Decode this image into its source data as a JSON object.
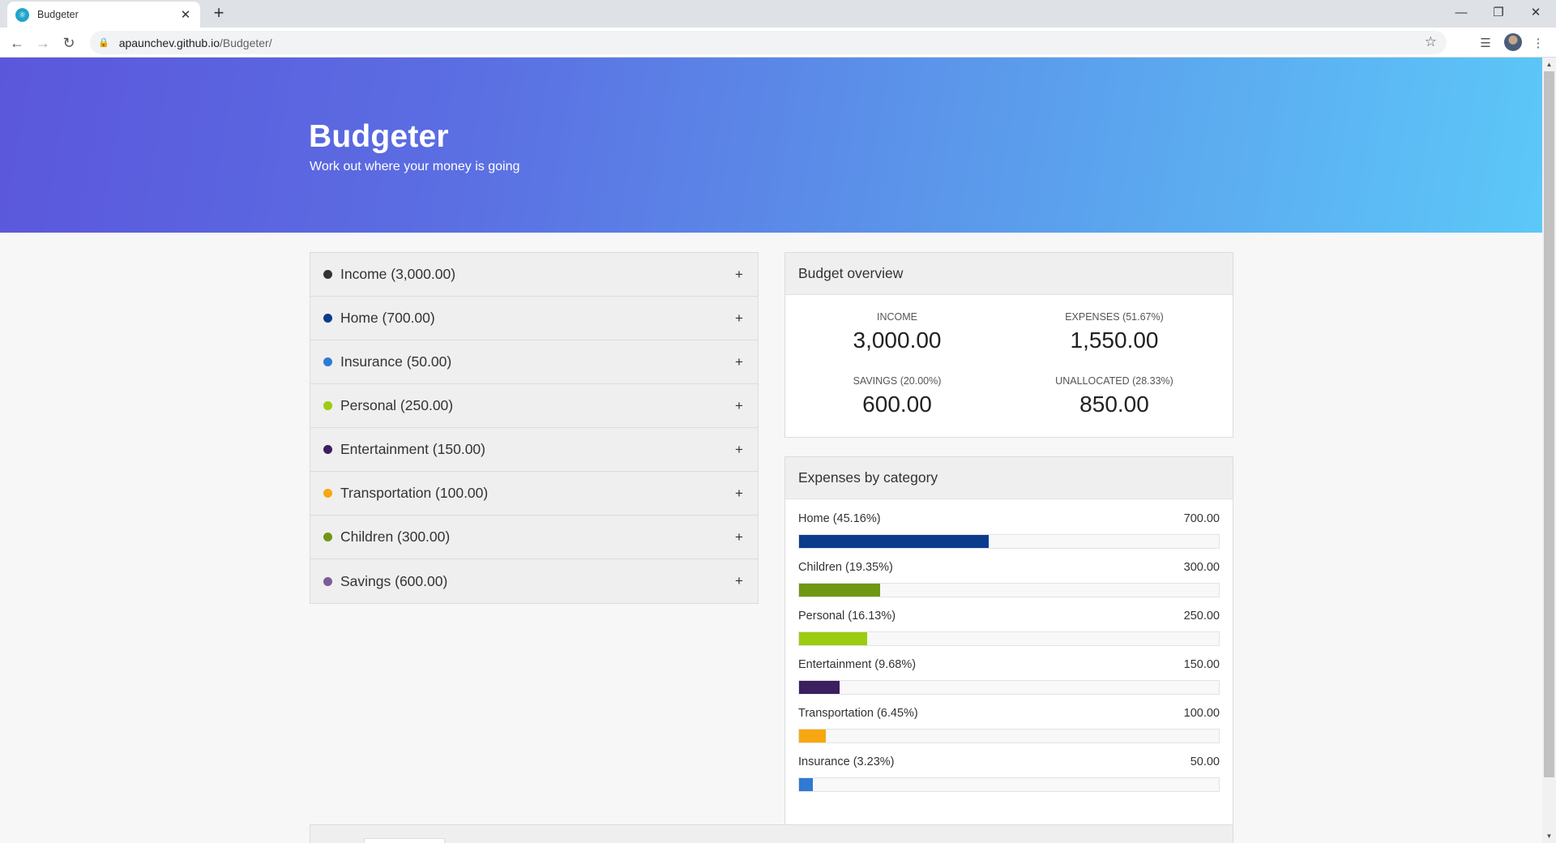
{
  "browser": {
    "tab_title": "Budgeter",
    "tab_close": "✕",
    "new_tab": "+",
    "url_host": "apaunchev.github.io",
    "url_path": "/Budgeter/"
  },
  "hero": {
    "title": "Budgeter",
    "subtitle": "Work out where your money is going"
  },
  "categories": [
    {
      "label": "Income (3,000.00)",
      "color": "#333333",
      "plus": "+"
    },
    {
      "label": "Home (700.00)",
      "color": "#0b3c8c",
      "plus": "+"
    },
    {
      "label": "Insurance (50.00)",
      "color": "#2f7ad4",
      "plus": "+"
    },
    {
      "label": "Personal (250.00)",
      "color": "#9ccc10",
      "plus": "+"
    },
    {
      "label": "Entertainment (150.00)",
      "color": "#3b1f5e",
      "plus": "+"
    },
    {
      "label": "Transportation (100.00)",
      "color": "#f7a712",
      "plus": "+"
    },
    {
      "label": "Children (300.00)",
      "color": "#6f9713",
      "plus": "+"
    },
    {
      "label": "Savings (600.00)",
      "color": "#7c5c96",
      "plus": "+"
    }
  ],
  "overview": {
    "title": "Budget overview",
    "income_label": "INCOME",
    "income_value": "3,000.00",
    "expenses_label": "EXPENSES (51.67%)",
    "expenses_value": "1,550.00",
    "savings_label": "SAVINGS (20.00%)",
    "savings_value": "600.00",
    "unallocated_label": "UNALLOCATED (28.33%)",
    "unallocated_value": "850.00"
  },
  "expenses": {
    "title": "Expenses by category",
    "items": [
      {
        "label": "Home (45.16%)",
        "value": "700.00",
        "fill_percent": 45.16,
        "color": "#0b3c8c"
      },
      {
        "label": "Children (19.35%)",
        "value": "300.00",
        "fill_percent": 19.35,
        "color": "#6f9713"
      },
      {
        "label": "Personal (16.13%)",
        "value": "250.00",
        "fill_percent": 16.13,
        "color": "#9ccc10"
      },
      {
        "label": "Entertainment (9.68%)",
        "value": "150.00",
        "fill_percent": 9.68,
        "color": "#3b1f5e"
      },
      {
        "label": "Transportation (6.45%)",
        "value": "100.00",
        "fill_percent": 6.45,
        "color": "#f7a712"
      },
      {
        "label": "Insurance (3.23%)",
        "value": "50.00",
        "fill_percent": 3.23,
        "color": "#2f7ad4"
      }
    ]
  }
}
